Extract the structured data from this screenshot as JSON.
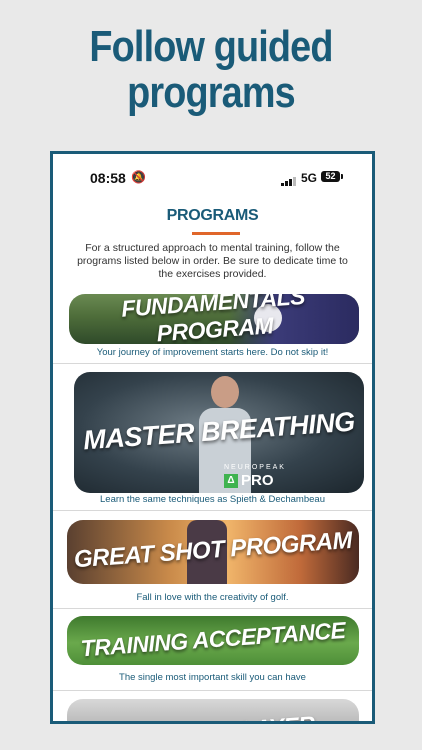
{
  "headline": {
    "line1": "Follow guided",
    "line2": "programs"
  },
  "status_bar": {
    "time": "08:58",
    "network": "5G",
    "battery": "52"
  },
  "page": {
    "title": "PROGRAMS",
    "intro": "For a structured approach to mental training, follow the programs listed below in order. Be sure to dedicate time to the exercises provided."
  },
  "programs": [
    {
      "title": "FUNDAMENTALS PROGRAM",
      "caption": "Your journey of improvement starts here. Do not skip it!"
    },
    {
      "title": "MASTER BREATHING",
      "caption": "Learn the same techniques as Spieth & Dechambeau",
      "brand": "NEUROPEAK",
      "badge": "PRO"
    },
    {
      "title": "GREAT SHOT PROGRAM",
      "caption": "Fall in love with the creativity of golf."
    },
    {
      "title": "TRAINING ACCEPTANCE",
      "caption": "The single most important skill you can have"
    },
    {
      "title": "ULTIMATE PLAYER",
      "caption": ""
    }
  ],
  "icons": {
    "silent_mode": "bell-slash-icon",
    "signal": "cellular-signal-icon",
    "battery": "battery-icon"
  },
  "colors": {
    "brand": "#1a5b78",
    "accent": "#e0662a",
    "background": "#e9e9e9"
  }
}
